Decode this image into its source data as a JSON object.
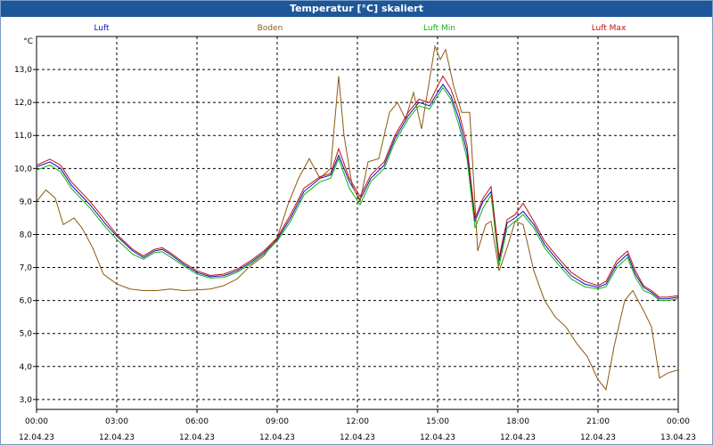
{
  "window": {
    "title": "Temperatur [°C] skaliert"
  },
  "chart_data": {
    "type": "line",
    "title": "Temperatur [°C] skaliert",
    "ylabel": "°C",
    "xlabel": "",
    "ylim": [
      2.7,
      14.0
    ],
    "y_ticks": [
      3,
      4,
      5,
      6,
      7,
      8,
      9,
      10,
      11,
      12,
      13
    ],
    "y_tick_labels": [
      "3,0",
      "4,0",
      "5,0",
      "6,0",
      "7,0",
      "8,0",
      "9,0",
      "10,0",
      "11,0",
      "12,0",
      "13,0"
    ],
    "xlim": [
      0,
      24
    ],
    "x_ticks": [
      0,
      3,
      6,
      9,
      12,
      15,
      18,
      21,
      24
    ],
    "x_tick_labels": [
      {
        "time": "00:00",
        "date": "12.04.23"
      },
      {
        "time": "03:00",
        "date": "12.04.23"
      },
      {
        "time": "06:00",
        "date": "12.04.23"
      },
      {
        "time": "09:00",
        "date": "12.04.23"
      },
      {
        "time": "12:00",
        "date": "12.04.23"
      },
      {
        "time": "15:00",
        "date": "12.04.23"
      },
      {
        "time": "18:00",
        "date": "12.04.23"
      },
      {
        "time": "21:00",
        "date": "12.04.23"
      },
      {
        "time": "00:00",
        "date": "13.04.23"
      }
    ],
    "grid": true,
    "legend_position": "top",
    "series": [
      {
        "name": "Luft",
        "color": "#1010c0",
        "x": [
          0,
          0.5,
          0.9,
          1.3,
          2,
          2.6,
          3,
          3.6,
          4,
          4.4,
          4.7,
          5,
          5.5,
          6,
          6.5,
          7,
          7.5,
          8,
          8.5,
          9,
          9.5,
          10,
          10.6,
          11,
          11.3,
          11.7,
          12.1,
          12.5,
          13,
          13.4,
          13.9,
          14.3,
          14.7,
          15,
          15.2,
          15.5,
          15.8,
          16.1,
          16.4,
          16.7,
          17,
          17.3,
          17.6,
          17.9,
          18.2,
          18.6,
          19,
          19.5,
          20,
          20.5,
          21,
          21.3,
          21.7,
          22.1,
          22.4,
          22.7,
          23,
          23.3,
          23.6,
          24
        ],
        "y": [
          10.05,
          10.2,
          10.0,
          9.5,
          8.9,
          8.3,
          7.95,
          7.5,
          7.3,
          7.5,
          7.55,
          7.4,
          7.1,
          6.85,
          6.72,
          6.75,
          6.9,
          7.15,
          7.45,
          7.85,
          8.5,
          9.3,
          9.7,
          9.8,
          10.4,
          9.6,
          9.05,
          9.7,
          10.1,
          10.9,
          11.6,
          12.0,
          11.9,
          12.3,
          12.55,
          12.2,
          11.5,
          10.5,
          8.4,
          9.0,
          9.3,
          7.2,
          8.35,
          8.5,
          8.7,
          8.3,
          7.7,
          7.2,
          6.75,
          6.5,
          6.4,
          6.5,
          7.1,
          7.4,
          6.8,
          6.4,
          6.25,
          6.05,
          6.05,
          6.1
        ]
      },
      {
        "name": "Boden",
        "color": "#8b5a10",
        "x": [
          0,
          0.35,
          0.7,
          1,
          1.4,
          1.7,
          2.1,
          2.5,
          3,
          3.5,
          4,
          4.5,
          5,
          5.5,
          6,
          6.5,
          7,
          7.5,
          8,
          8.5,
          9,
          9.4,
          9.8,
          10.2,
          10.6,
          11,
          11.3,
          11.5,
          11.8,
          12.1,
          12.4,
          12.8,
          13.2,
          13.5,
          13.8,
          14.1,
          14.4,
          14.7,
          14.9,
          15.1,
          15.3,
          15.6,
          15.9,
          16.2,
          16.5,
          16.8,
          17.0,
          17.3,
          17.6,
          17.9,
          18.2,
          18.6,
          19,
          19.4,
          19.8,
          20.2,
          20.6,
          21,
          21.3,
          21.6,
          22,
          22.3,
          22.7,
          23,
          23.3,
          23.6,
          24
        ],
        "y": [
          9.0,
          9.35,
          9.1,
          8.3,
          8.5,
          8.2,
          7.6,
          6.8,
          6.5,
          6.35,
          6.3,
          6.3,
          6.35,
          6.3,
          6.32,
          6.35,
          6.45,
          6.65,
          7.05,
          7.35,
          7.9,
          8.9,
          9.7,
          10.3,
          9.7,
          10.0,
          12.8,
          11.0,
          9.5,
          9.0,
          10.2,
          10.3,
          11.7,
          12.0,
          11.5,
          12.3,
          11.2,
          12.7,
          13.7,
          13.3,
          13.6,
          12.5,
          11.7,
          11.7,
          7.5,
          8.3,
          8.4,
          6.9,
          7.6,
          8.4,
          8.3,
          6.9,
          6.0,
          5.5,
          5.2,
          4.7,
          4.3,
          3.6,
          3.3,
          4.6,
          6.0,
          6.3,
          5.7,
          5.2,
          3.65,
          3.8,
          3.9
        ]
      },
      {
        "name": "Luft Min",
        "color": "#10b010",
        "x": [
          0,
          0.5,
          0.9,
          1.3,
          2,
          2.6,
          3,
          3.6,
          4,
          4.4,
          4.7,
          5,
          5.5,
          6,
          6.5,
          7,
          7.5,
          8,
          8.5,
          9,
          9.5,
          10,
          10.6,
          11,
          11.3,
          11.7,
          12.1,
          12.5,
          13,
          13.4,
          13.9,
          14.3,
          14.7,
          15,
          15.2,
          15.5,
          15.8,
          16.1,
          16.4,
          16.7,
          17,
          17.3,
          17.6,
          17.9,
          18.2,
          18.6,
          19,
          19.5,
          20,
          20.5,
          21,
          21.3,
          21.7,
          22.1,
          22.4,
          22.7,
          23,
          23.3,
          23.6,
          24
        ],
        "y": [
          9.95,
          10.1,
          9.9,
          9.4,
          8.8,
          8.2,
          7.85,
          7.4,
          7.25,
          7.45,
          7.48,
          7.32,
          7.05,
          6.8,
          6.68,
          6.7,
          6.85,
          7.1,
          7.4,
          7.8,
          8.4,
          9.2,
          9.6,
          9.7,
          10.3,
          9.4,
          8.9,
          9.6,
          10.0,
          10.8,
          11.5,
          11.9,
          11.8,
          12.2,
          12.45,
          12.1,
          11.3,
          10.3,
          8.2,
          8.8,
          9.2,
          7.05,
          8.2,
          8.4,
          8.6,
          8.2,
          7.6,
          7.1,
          6.65,
          6.42,
          6.35,
          6.42,
          7.0,
          7.3,
          6.7,
          6.3,
          6.2,
          6.0,
          6.0,
          6.05
        ]
      },
      {
        "name": "Luft Max",
        "color": "#c01010",
        "x": [
          0,
          0.5,
          0.9,
          1.3,
          2,
          2.6,
          3,
          3.6,
          4,
          4.4,
          4.7,
          5,
          5.5,
          6,
          6.5,
          7,
          7.5,
          8,
          8.5,
          9,
          9.5,
          10,
          10.6,
          11,
          11.3,
          11.7,
          12.1,
          12.5,
          13,
          13.4,
          13.9,
          14.3,
          14.7,
          15,
          15.2,
          15.5,
          15.8,
          16.1,
          16.4,
          16.7,
          17,
          17.3,
          17.6,
          17.9,
          18.2,
          18.6,
          19,
          19.5,
          20,
          20.5,
          21,
          21.3,
          21.7,
          22.1,
          22.4,
          22.7,
          23,
          23.3,
          23.6,
          24
        ],
        "y": [
          10.1,
          10.28,
          10.1,
          9.6,
          9.0,
          8.4,
          8.0,
          7.55,
          7.35,
          7.55,
          7.6,
          7.45,
          7.15,
          6.9,
          6.76,
          6.8,
          6.95,
          7.2,
          7.5,
          7.9,
          8.6,
          9.4,
          9.75,
          9.85,
          10.6,
          9.7,
          9.15,
          9.8,
          10.2,
          11.0,
          11.7,
          12.1,
          12.0,
          12.5,
          12.8,
          12.4,
          11.7,
          10.7,
          8.5,
          9.1,
          9.45,
          7.3,
          8.45,
          8.6,
          8.95,
          8.4,
          7.8,
          7.3,
          6.85,
          6.58,
          6.45,
          6.58,
          7.2,
          7.5,
          6.9,
          6.45,
          6.3,
          6.1,
          6.1,
          6.15
        ]
      }
    ]
  }
}
